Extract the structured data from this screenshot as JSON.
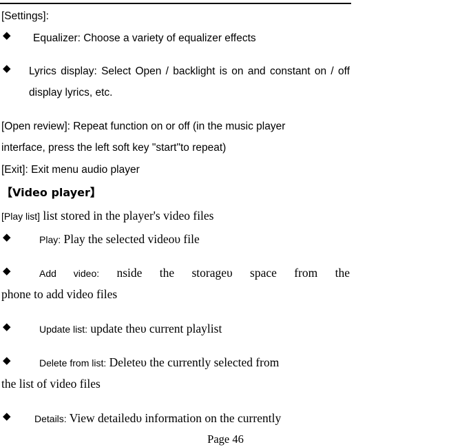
{
  "document": {
    "page_label": "Page 46",
    "sections": {
      "settings": {
        "heading": "[Settings]:",
        "bullets": [
          {
            "marker": "◆",
            "text": "Equalizer: Choose a variety of equalizer effects"
          },
          {
            "marker": "◆",
            "text": "Lyrics display: Select Open / backlight is on and constant on / off display lyrics, etc."
          }
        ]
      },
      "open_review": {
        "line1": "[Open review]: Repeat function on or off (in the music player",
        "line2": "interface, press the left soft key \"start\"to repeat)"
      },
      "exit": {
        "line": "[Exit]: Exit menu audio player"
      },
      "video_player": {
        "heading": "【Video player】",
        "play_list": {
          "label": "[Play list]",
          "text": " list stored in the player's video files"
        },
        "bullets": [
          {
            "marker": "◆",
            "label": "Play:",
            "text": " Play the selected videoυ file"
          },
          {
            "marker": "◆",
            "label": "Add video:",
            "text": " nside the storageυ space from the",
            "continuation": "phone to add video files"
          },
          {
            "marker": "◆",
            "label": "Update list:",
            "text": " update theυ current playlist"
          },
          {
            "marker": "◆",
            "label": "Delete from list:",
            "text": " Deleteυ the currently selected from",
            "continuation": "the list of video files"
          },
          {
            "marker": "◆",
            "label": "Details:",
            "text": " View detailedυ information on the currently"
          }
        ]
      }
    }
  }
}
